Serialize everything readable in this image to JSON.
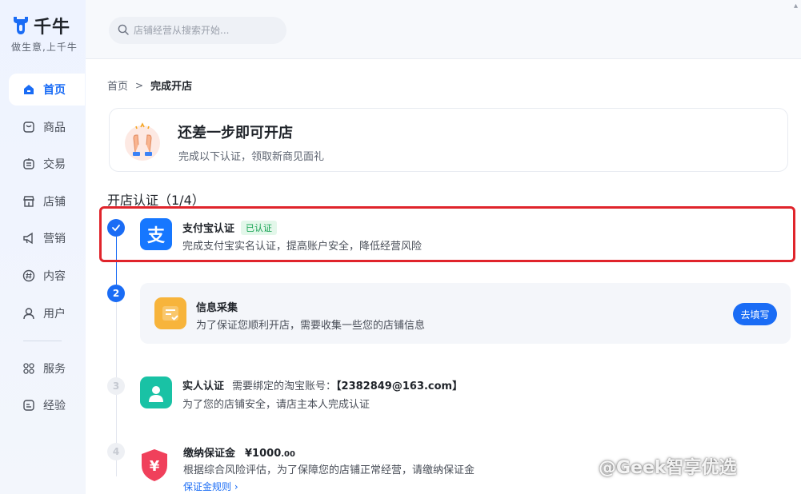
{
  "sidebar": {
    "logo_text": "千牛",
    "slogan": "做生意,上千牛",
    "items": [
      {
        "label": "首页",
        "icon": "home-icon",
        "active": true
      },
      {
        "label": "商品",
        "icon": "product-icon",
        "active": false
      },
      {
        "label": "交易",
        "icon": "trade-icon",
        "active": false
      },
      {
        "label": "店铺",
        "icon": "store-icon",
        "active": false
      },
      {
        "label": "营销",
        "icon": "megaphone-icon",
        "active": false
      },
      {
        "label": "内容",
        "icon": "hashtag-icon",
        "active": false
      },
      {
        "label": "用户",
        "icon": "user-icon",
        "active": false
      }
    ],
    "bottom_items": [
      {
        "label": "服务",
        "icon": "grid-icon"
      },
      {
        "label": "经验",
        "icon": "note-icon"
      }
    ]
  },
  "search": {
    "placeholder": "店铺经营从搜索开始..."
  },
  "breadcrumb": {
    "home": "首页",
    "current": "完成开店"
  },
  "banner": {
    "title": "还差一步即可开店",
    "subtitle": "完成以下认证，领取新商见面礼"
  },
  "section_title": "开店认证（1/4）",
  "steps": [
    {
      "number": "1",
      "icon": "alipay-icon",
      "icon_glyph": "支",
      "title": "支付宝认证",
      "badge": "已认证",
      "desc": "完成支付宝实名认证，提高账户安全，降低经营风险",
      "status": "done"
    },
    {
      "number": "2",
      "icon": "form-icon",
      "title": "信息采集",
      "desc": "为了保证您顺利开店，需要收集一些您的店铺信息",
      "status": "active",
      "button": "去填写"
    },
    {
      "number": "3",
      "icon": "person-icon",
      "title": "实人认证",
      "extra_label": "需要绑定的淘宝账号：",
      "extra_value": "【2382849@163.com】",
      "desc": "为了您的店铺安全，请店主本人完成认证",
      "status": "pending"
    },
    {
      "number": "4",
      "icon": "shield-yuan-icon",
      "icon_glyph": "¥",
      "title": "缴纳保证金",
      "amount_main": "¥1000",
      "amount_cents": ".00",
      "desc": "根据综合风险评估，为了保障您的店铺正常经营，请缴纳保证金",
      "link": "保证金规则 ›",
      "status": "pending"
    }
  ],
  "watermark": "@Geek智享优选",
  "corner_mark": "▴",
  "colors": {
    "accent": "#1a6cf5",
    "highlight": "#e0242b",
    "success": "#12a150"
  }
}
